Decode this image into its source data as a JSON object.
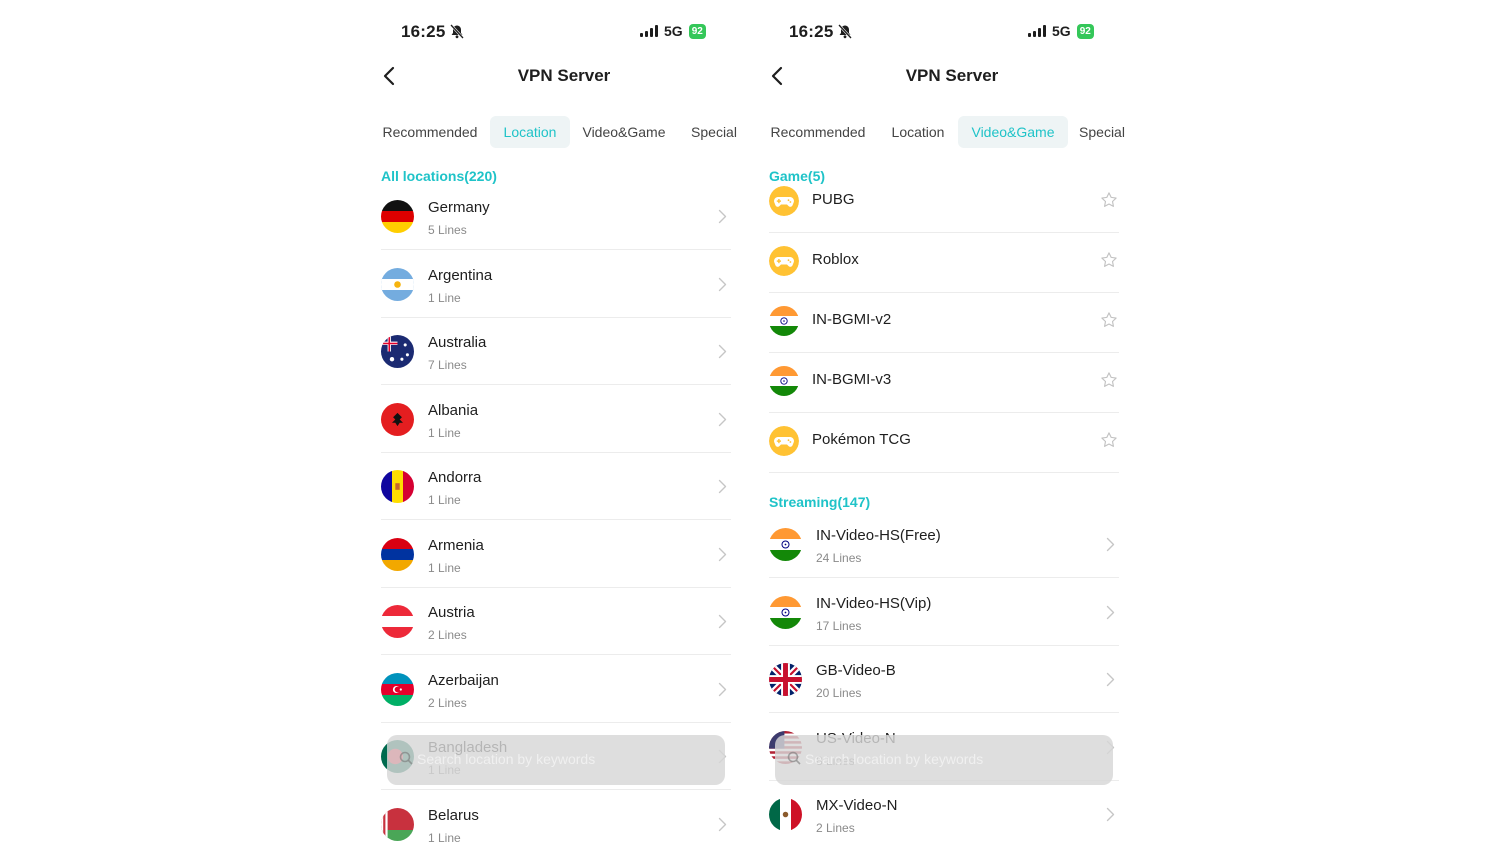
{
  "status": {
    "time": "16:25",
    "network": "5G",
    "battery": "92"
  },
  "nav": {
    "title": "VPN Server"
  },
  "tabs": [
    "Recommended",
    "Location",
    "Video&Game",
    "Special"
  ],
  "left_screen": {
    "active_tab": "Location",
    "section_title": "All locations(220)",
    "locations": [
      {
        "name": "Germany",
        "lines": "5 Lines",
        "flag": "germany"
      },
      {
        "name": "Argentina",
        "lines": "1 Line",
        "flag": "argentina"
      },
      {
        "name": "Australia",
        "lines": "7 Lines",
        "flag": "australia"
      },
      {
        "name": "Albania",
        "lines": "1 Line",
        "flag": "albania"
      },
      {
        "name": "Andorra",
        "lines": "1 Line",
        "flag": "andorra"
      },
      {
        "name": "Armenia",
        "lines": "1 Line",
        "flag": "armenia"
      },
      {
        "name": "Austria",
        "lines": "2 Lines",
        "flag": "austria"
      },
      {
        "name": "Azerbaijan",
        "lines": "2 Lines",
        "flag": "azerbaijan"
      },
      {
        "name": "Bangladesh",
        "lines": "1 Line",
        "flag": "bangladesh"
      },
      {
        "name": "Belarus",
        "lines": "1 Line",
        "flag": "belarus"
      }
    ],
    "search_placeholder": "Search location by keywords"
  },
  "right_screen": {
    "active_tab": "Video&Game",
    "game_title": "Game(5)",
    "games": [
      {
        "name": "PUBG",
        "icon": "gamepad-icon"
      },
      {
        "name": "Roblox",
        "icon": "gamepad-icon"
      },
      {
        "name": "IN-BGMI-v2",
        "icon": "india-flag-icon"
      },
      {
        "name": "IN-BGMI-v3",
        "icon": "india-flag-icon"
      },
      {
        "name": "Pokémon TCG",
        "icon": "gamepad-icon"
      }
    ],
    "streaming_title": "Streaming(147)",
    "streaming": [
      {
        "name": "IN-Video-HS(Free)",
        "lines": "24 Lines",
        "flag": "india"
      },
      {
        "name": "IN-Video-HS(Vip)",
        "lines": "17 Lines",
        "flag": "india"
      },
      {
        "name": "GB-Video-B",
        "lines": "20 Lines",
        "flag": "uk"
      },
      {
        "name": "US-Video-N",
        "lines": "8 Lines",
        "flag": "usa"
      },
      {
        "name": "MX-Video-N",
        "lines": "2 Lines",
        "flag": "mexico"
      }
    ],
    "search_placeholder": "Search location by keywords"
  },
  "colors": {
    "accent": "#1fc3c8",
    "text": "#1e1e1e",
    "subtext": "#8a8a8a",
    "battery": "#34c759"
  }
}
